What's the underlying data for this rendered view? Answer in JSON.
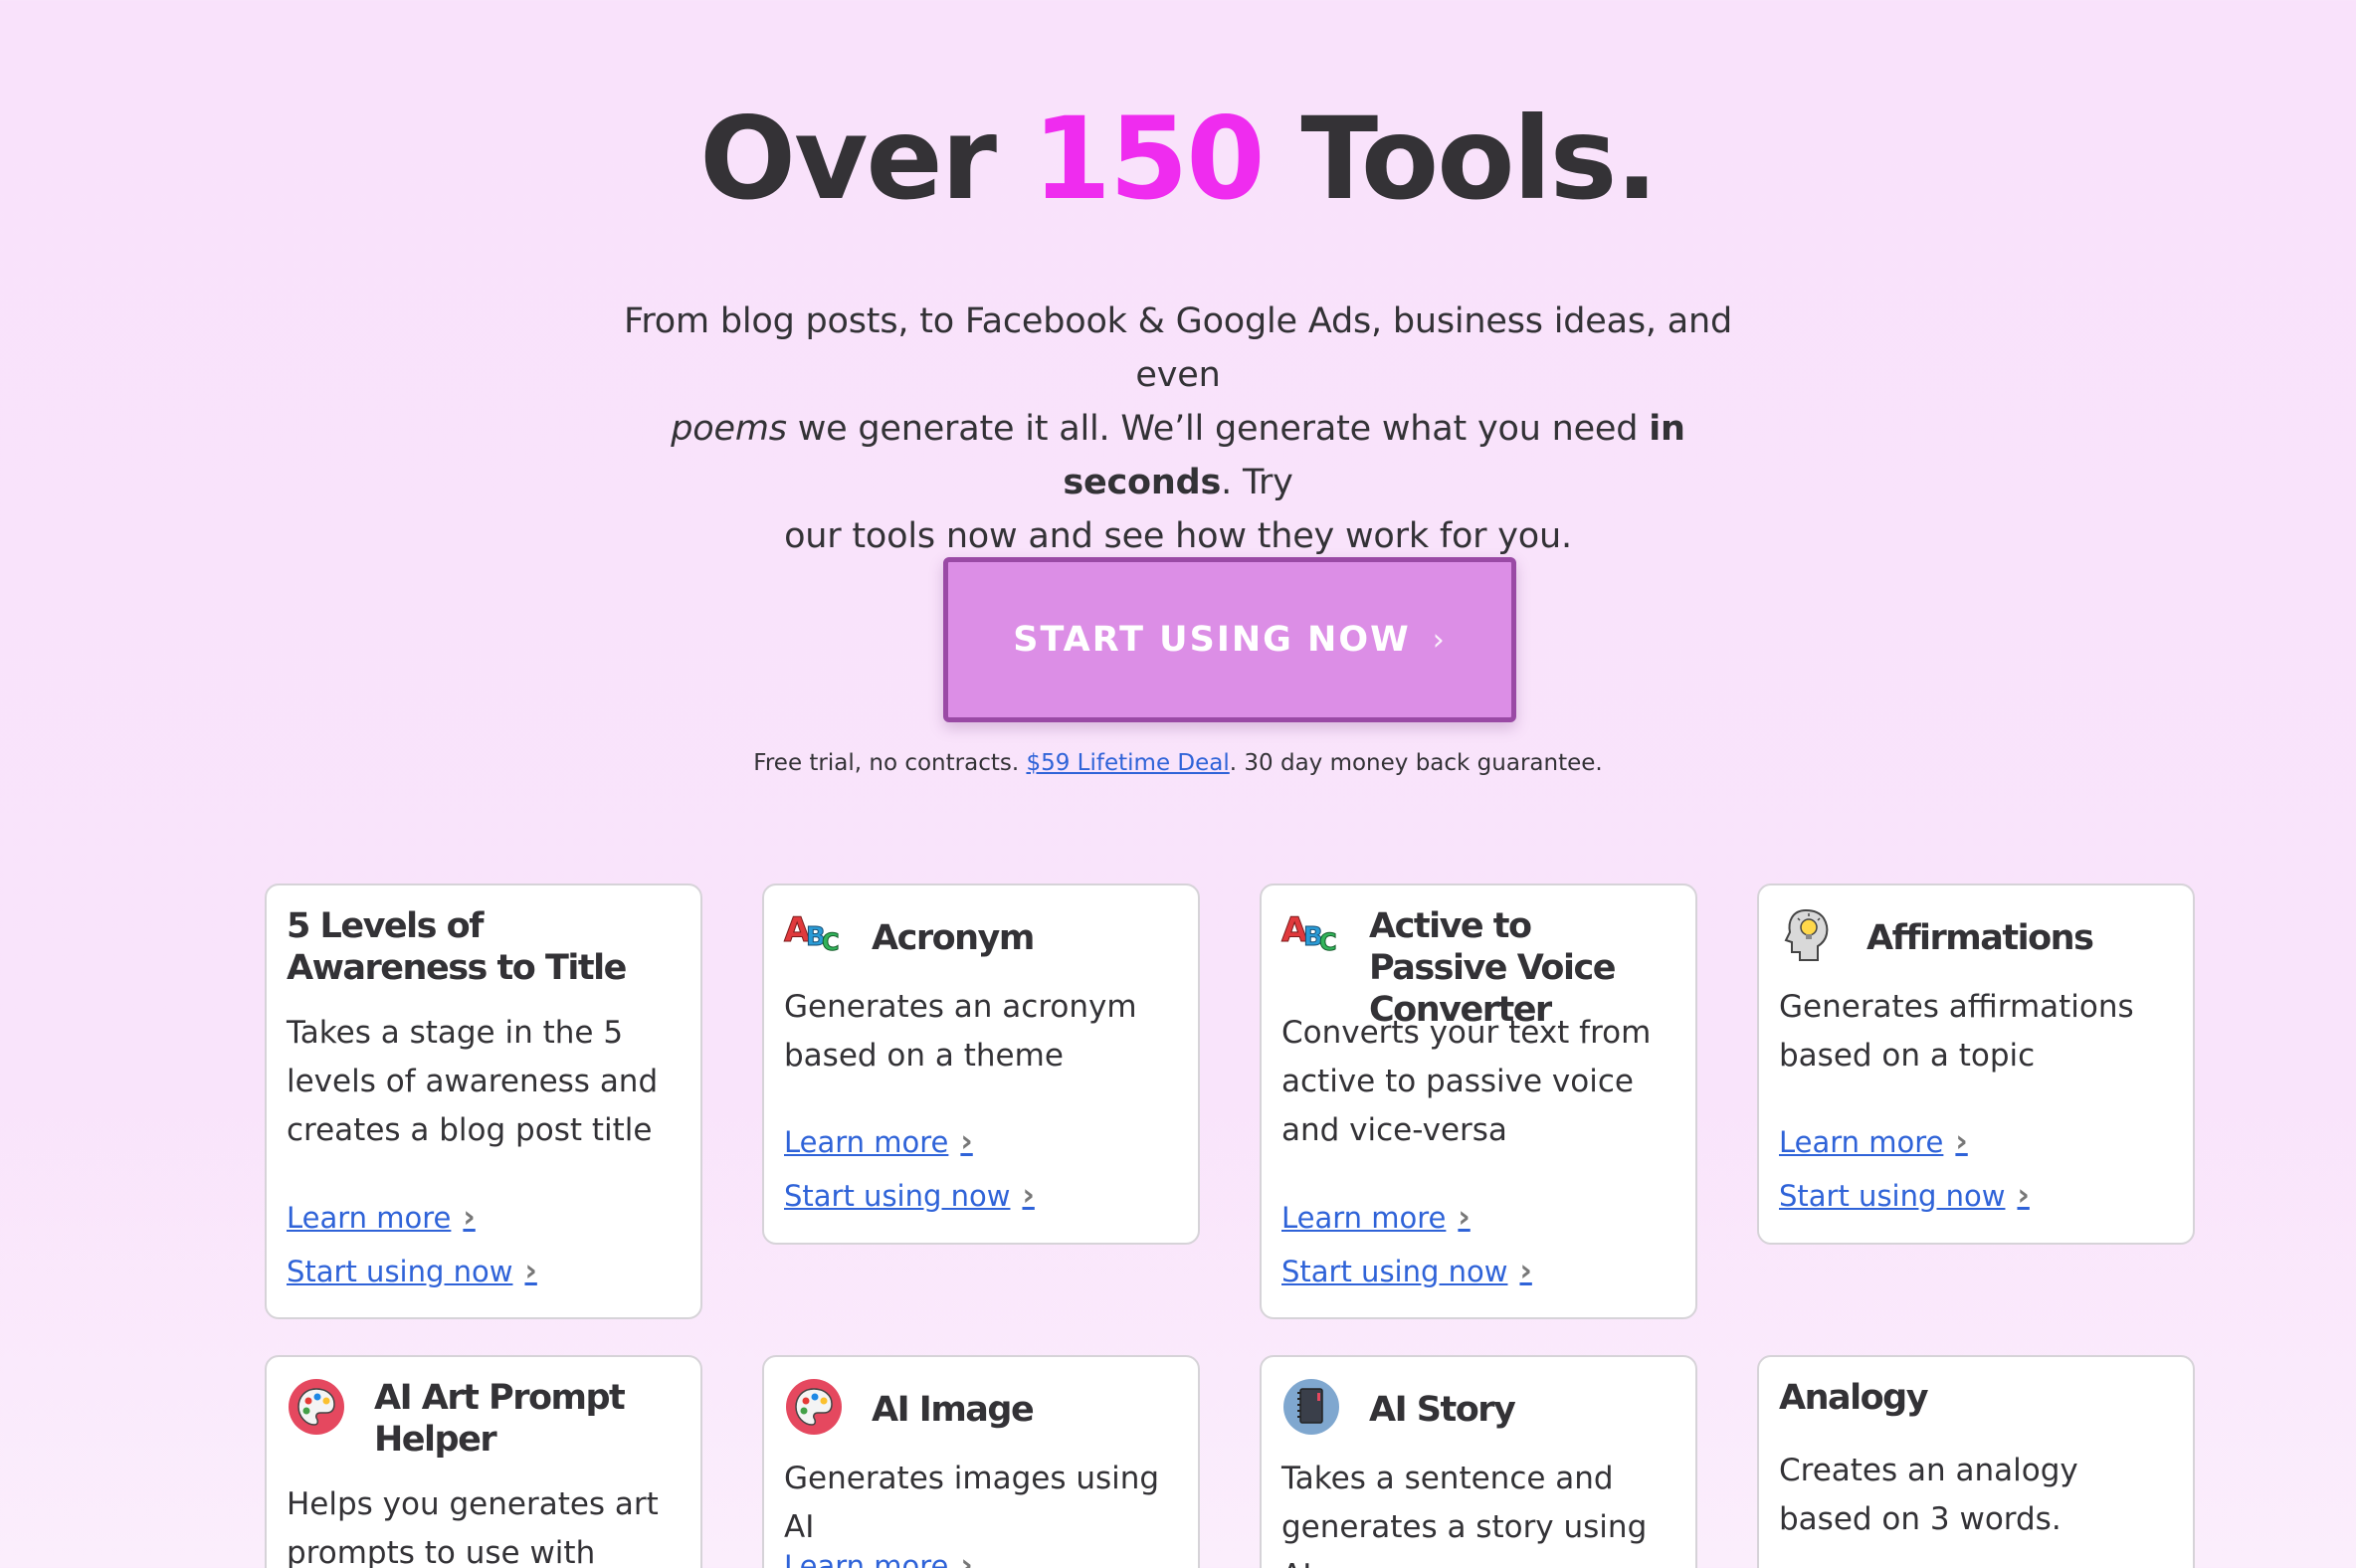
{
  "hero": {
    "title_pre": "Over",
    "title_accent": "150",
    "title_post": "Tools.",
    "sub_1": "From blog posts, to Facebook & Google Ads, business ideas, and even",
    "sub_2_em": "poems",
    "sub_2": "we generate it all. We’ll generate what you need",
    "sub_2_bold": "in seconds",
    "sub_2_end": ". Try",
    "sub_3": "our tools now and see how they work for you."
  },
  "cta": {
    "label": "START USING NOW",
    "chevron": "›"
  },
  "guarantee": {
    "pre": "Free trial, no contracts.",
    "link": "$59 Lifetime Deal",
    "post": ". 30 day money back guarantee."
  },
  "colors": {
    "accent": "#ef2cef",
    "button": "#dc8ee6",
    "button_border": "#9a4aa5",
    "link": "#2f63d8"
  },
  "cards": [
    {
      "title": "5 Levels of Awareness to Title",
      "icon": "none",
      "desc": "Takes a stage in the 5 levels of awareness and creates a blog post title",
      "learn": "Learn more",
      "start": "Start using now"
    },
    {
      "title": "Acronym",
      "icon": "abc-blocks-icon",
      "desc": "Generates an acronym based on a theme",
      "learn": "Learn more",
      "start": "Start using now"
    },
    {
      "title": "Active to Passive Voice Converter",
      "icon": "abc-blocks-icon",
      "desc": "Converts your text from active to passive voice and vice-versa",
      "learn": "Learn more",
      "start": "Start using now"
    },
    {
      "title": "Affirmations",
      "icon": "head-lightbulb-icon",
      "desc": "Generates affirmations based on a topic",
      "learn": "Learn more",
      "start": "Start using now"
    },
    {
      "title": "AI Art Prompt Helper",
      "icon": "palette-icon",
      "desc": "Helps you generates art prompts to use with",
      "learn": "",
      "start": ""
    },
    {
      "title": "AI Image",
      "icon": "palette-icon",
      "desc": "Generates images using AI",
      "learn": "Learn more",
      "start": ""
    },
    {
      "title": "AI Story",
      "icon": "notebook-icon",
      "desc": "Takes a sentence and generates a story using AI.",
      "learn": "",
      "start": ""
    },
    {
      "title": "Analogy",
      "icon": "none",
      "desc": "Creates an analogy based on 3 words.",
      "learn": "",
      "start": ""
    }
  ]
}
